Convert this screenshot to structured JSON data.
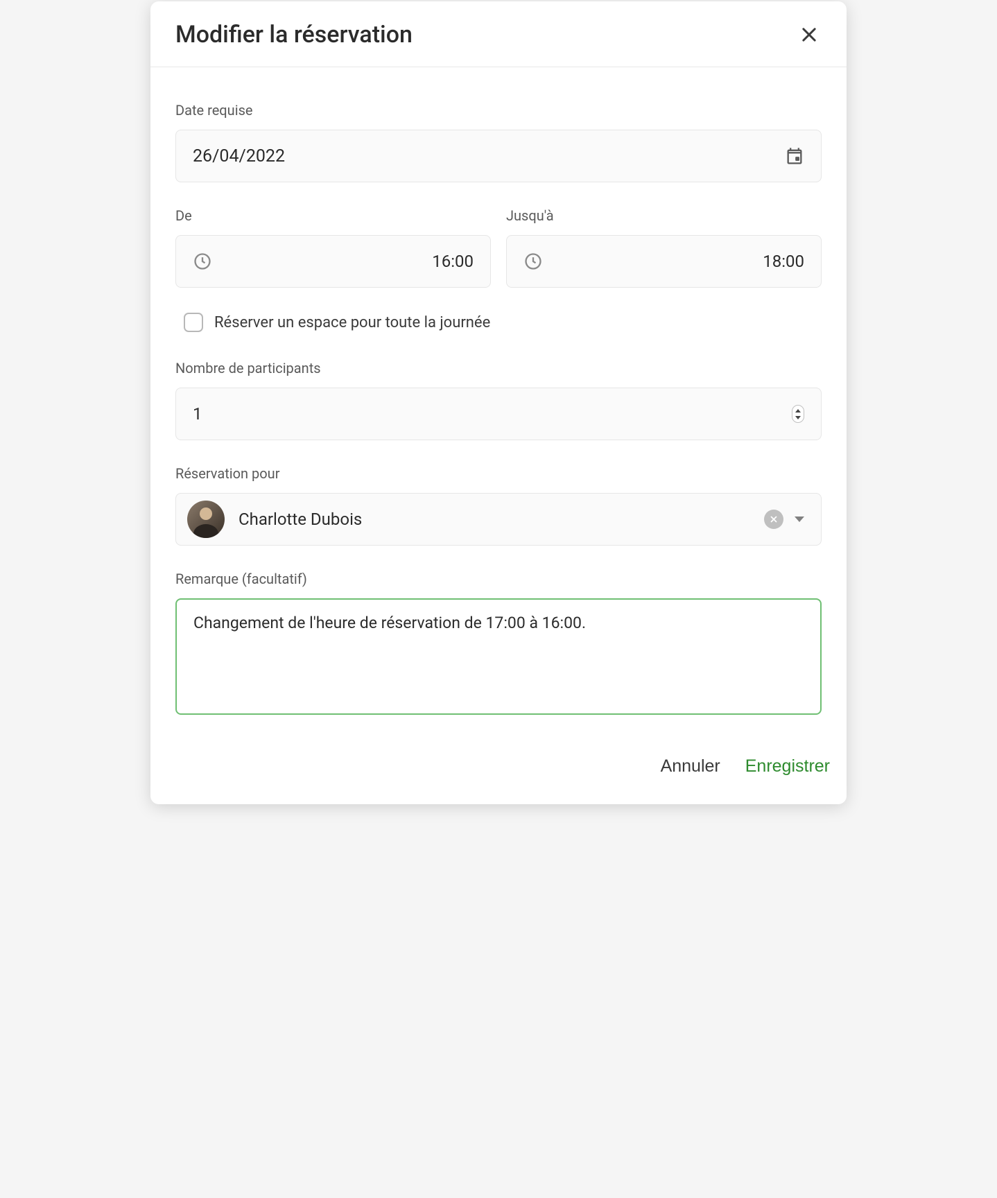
{
  "dialog": {
    "title": "Modifier la réservation"
  },
  "form": {
    "date": {
      "label": "Date requise",
      "value": "26/04/2022"
    },
    "timeFrom": {
      "label": "De",
      "value": "16:00"
    },
    "timeTo": {
      "label": "Jusqu'à",
      "value": "18:00"
    },
    "allDay": {
      "label": "Réserver un espace pour toute la journée",
      "checked": false
    },
    "participants": {
      "label": "Nombre de participants",
      "value": "1"
    },
    "bookingFor": {
      "label": "Réservation pour",
      "personName": "Charlotte Dubois"
    },
    "note": {
      "label": "Remarque (facultatif)",
      "value": "Changement de l'heure de réservation de 17:00 à 16:00."
    }
  },
  "actions": {
    "cancel": "Annuler",
    "save": "Enregistrer"
  }
}
